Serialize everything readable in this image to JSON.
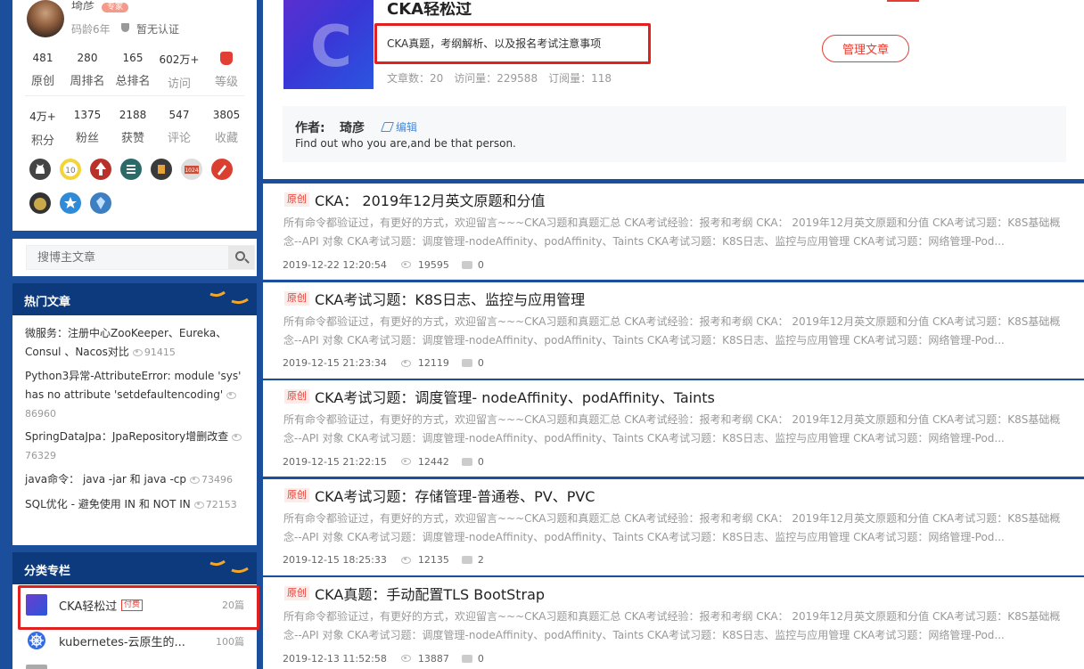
{
  "author": {
    "name": "琦彦",
    "level_badge": "专家",
    "code_age": "码龄6年",
    "verify": "暂无认证",
    "stats_row1": [
      {
        "value": "481",
        "label": "原创"
      },
      {
        "value": "280",
        "label": "周排名"
      },
      {
        "value": "165",
        "label": "总排名"
      },
      {
        "value": "602万+",
        "label": "访问"
      },
      {
        "value": "",
        "label": "等级"
      }
    ],
    "stats_row2": [
      {
        "value": "4万+",
        "label": "积分"
      },
      {
        "value": "1375",
        "label": "粉丝"
      },
      {
        "value": "2188",
        "label": "获赞"
      },
      {
        "value": "547",
        "label": "评论"
      },
      {
        "value": "3805",
        "label": "收藏"
      }
    ]
  },
  "search": {
    "placeholder": "搜博主文章"
  },
  "hot": {
    "title": "热门文章",
    "items": [
      {
        "title": "微服务：注册中心ZooKeeper、Eureka、Consul 、Nacos对比",
        "views": "91415"
      },
      {
        "title": "Python3异常-AttributeError: module 'sys' has no attribute 'setdefaultencoding'",
        "views": "86960"
      },
      {
        "title": "SpringDataJpa：JpaRepository增删改查",
        "views": "76329"
      },
      {
        "title": "java命令： java -jar 和 java -cp",
        "views": "73496"
      },
      {
        "title": "SQL优化 - 避免使用 IN 和 NOT IN",
        "views": "72153"
      }
    ]
  },
  "columns": {
    "title": "分类专栏",
    "items": [
      {
        "name": "CKA轻松过",
        "tag": "付费",
        "count": "20篇"
      },
      {
        "name": "kubernetes-云原生的...",
        "tag": "",
        "count": "100篇"
      }
    ]
  },
  "column_header": {
    "title": "CKA轻松过",
    "desc": "CKA真题，考纲解析、以及报名考试注意事项",
    "stats": "文章数：20　访问量：229588　订阅量：118",
    "manage_button": "管理文章",
    "cover_letter": "C",
    "author_label": "作者:",
    "author_name": "琦彦",
    "edit_label": "编辑",
    "motto": "Find out who you are,and be that person."
  },
  "posts": [
    {
      "tag": "原创",
      "title": "CKA： 2019年12月英文原题和分值",
      "date": "2019-12-22 12:20:54",
      "views": "19595",
      "comments": "0"
    },
    {
      "tag": "原创",
      "title": "CKA考试习题：K8S日志、监控与应用管理",
      "date": "2019-12-15 21:23:34",
      "views": "12119",
      "comments": "0"
    },
    {
      "tag": "原创",
      "title": "CKA考试习题：调度管理- nodeAffinity、podAffinity、Taints",
      "date": "2019-12-15 21:22:15",
      "views": "12442",
      "comments": "0"
    },
    {
      "tag": "原创",
      "title": "CKA考试习题：存储管理-普通卷、PV、PVC",
      "date": "2019-12-15 18:25:33",
      "views": "12135",
      "comments": "2"
    },
    {
      "tag": "原创",
      "title": "CKA真题：手动配置TLS BootStrap",
      "date": "2019-12-13 11:52:58",
      "views": "13887",
      "comments": "0"
    }
  ],
  "post_desc": "所有命令都验证过，有更好的方式，欢迎留言~~~CKA习题和真题汇总 CKA考试经验：报考和考纲 CKA： 2019年12月英文原题和分值 CKA考试习题：K8S基础概念--API 对象 CKA考试习题：调度管理-nodeAffinity、podAffinity、Taints CKA考试习题：K8S日志、监控与应用管理 CKA考试习题：网络管理-Pod...",
  "colors": {
    "accent": "#e33e33",
    "nav_blue": "#0c3a7d",
    "page_blue": "#1c4f9b",
    "highlight_box": "#e12020"
  }
}
